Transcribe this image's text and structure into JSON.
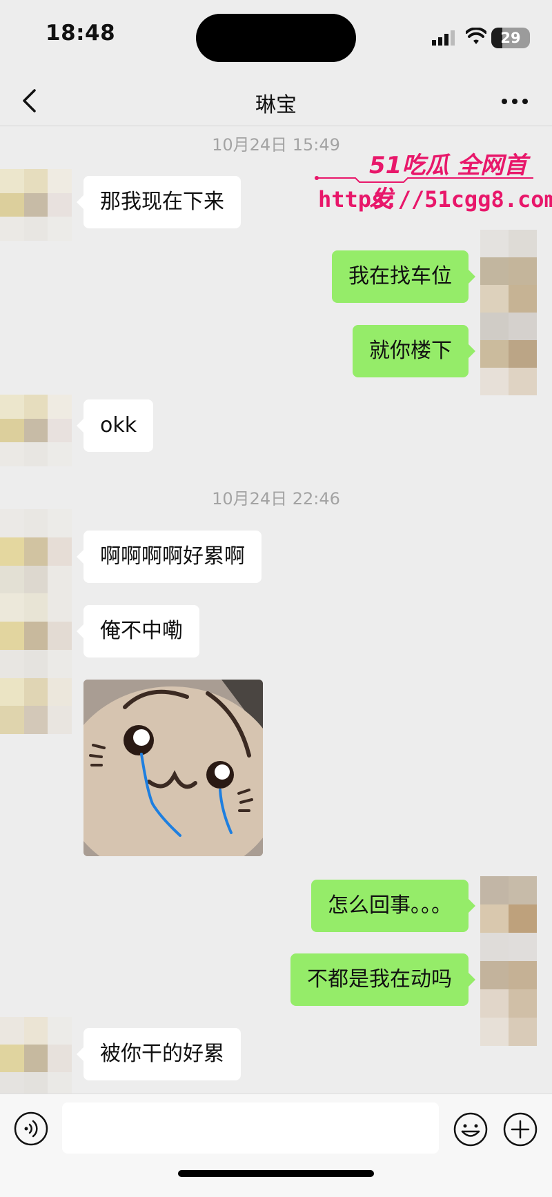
{
  "status": {
    "time": "18:48",
    "battery": "29",
    "battery_level": 0.29
  },
  "header": {
    "title": "琳宝",
    "back_icon": "chevron-left-icon",
    "more_icon": "ellipsis-icon"
  },
  "watermark": {
    "brand": "51吃瓜 全网首发",
    "url": "https://51cgg8.com"
  },
  "chat": {
    "timestamp_1": "10月24日 15:49",
    "timestamp_2": "10月24日 22:46",
    "messages": [
      {
        "side": "in",
        "text": "那我现在下来"
      },
      {
        "side": "out",
        "text": "我在找车位"
      },
      {
        "side": "out",
        "text": "就你楼下"
      },
      {
        "side": "in",
        "text": "okk"
      },
      {
        "side": "in",
        "text": "啊啊啊啊好累啊"
      },
      {
        "side": "in",
        "text": "俺不中嘞"
      },
      {
        "side": "in",
        "type": "sticker",
        "description": "crying-hamster-sticker"
      },
      {
        "side": "out",
        "text": "怎么回事。。。"
      },
      {
        "side": "out",
        "text": "不都是我在动吗"
      },
      {
        "side": "in",
        "text": "被你干的好累"
      }
    ]
  },
  "inputbar": {
    "voice_icon": "voice-icon",
    "emoji_icon": "emoji-icon",
    "plus_icon": "plus-icon"
  },
  "colors": {
    "background": "#ededed",
    "outgoing": "#95ec69",
    "incoming": "#ffffff",
    "watermark": "#e8176a"
  }
}
